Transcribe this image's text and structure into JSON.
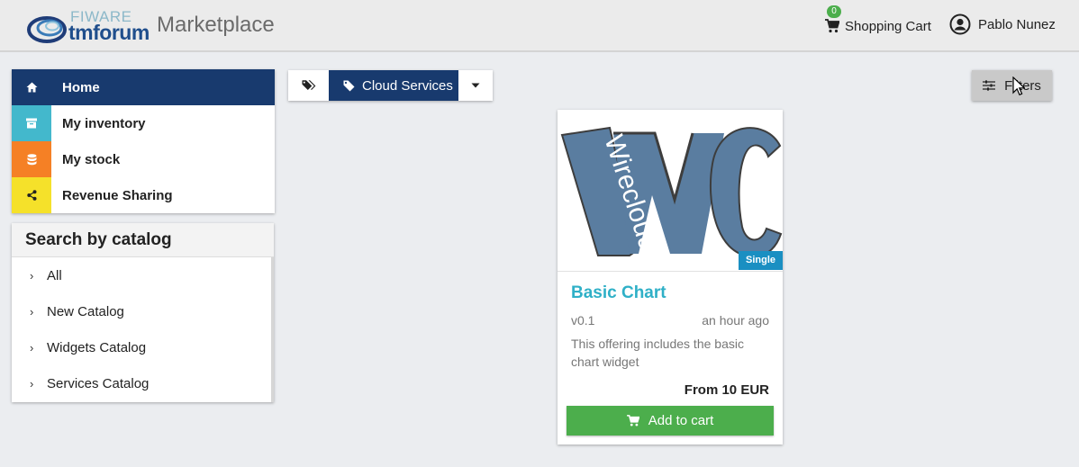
{
  "header": {
    "logo": {
      "line1": "FIWARE",
      "line2": "tmforum"
    },
    "app_title": "Marketplace",
    "cart": {
      "count": "0",
      "label": "Shopping Cart"
    },
    "user": {
      "name": "Pablo Nunez"
    }
  },
  "nav": {
    "items": [
      {
        "label": "Home",
        "icon": "home-icon",
        "color": "#183a6e",
        "active": true
      },
      {
        "label": "My inventory",
        "icon": "archive-icon",
        "color": "#43b8cc"
      },
      {
        "label": "My stock",
        "icon": "database-icon",
        "color": "#f58025"
      },
      {
        "label": "Revenue Sharing",
        "icon": "share-icon",
        "color": "#f5e12a"
      }
    ]
  },
  "catalog": {
    "title": "Search by catalog",
    "items": [
      {
        "label": "All"
      },
      {
        "label": "New Catalog"
      },
      {
        "label": "Widgets Catalog"
      },
      {
        "label": "Services Catalog"
      }
    ]
  },
  "category_bar": {
    "selected": "Cloud Services"
  },
  "filters": {
    "label": "Filters"
  },
  "offering": {
    "image_text": "Wirecloud",
    "badge": "Single",
    "title": "Basic Chart",
    "version": "v0.1",
    "time": "an hour ago",
    "description": "This offering includes the basic chart widget",
    "price": "From 10 EUR",
    "button": "Add to cart"
  },
  "colors": {
    "primary": "#183a6e",
    "accent": "#2fb0c7",
    "success": "#4cae4c",
    "badge": "#1a8fc2"
  }
}
